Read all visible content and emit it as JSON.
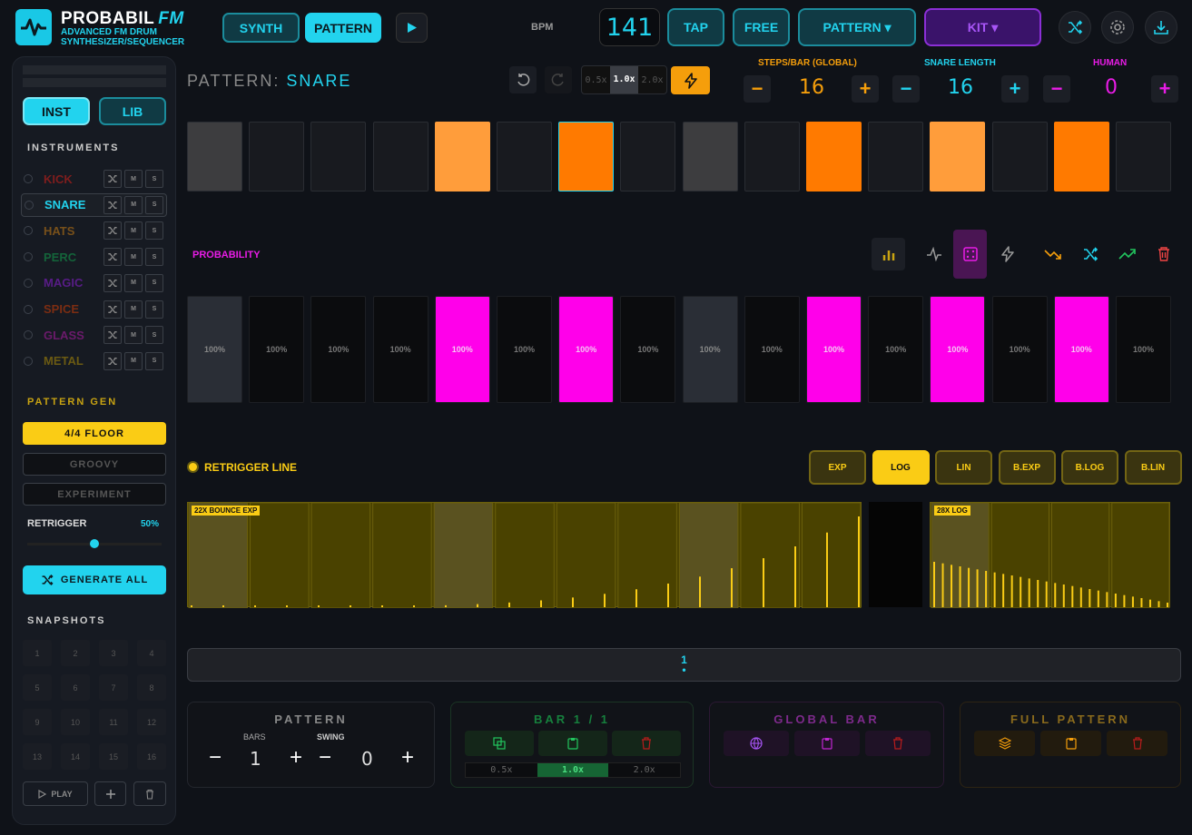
{
  "app": {
    "title": "PROBABIL",
    "title_suffix": "FM",
    "subtitle_line1": "ADVANCED FM DRUM",
    "subtitle_line2": "SYNTHESIZER/SEQUENCER"
  },
  "header": {
    "tab_synth": "SYNTH",
    "tab_pattern": "PATTERN",
    "bpm_label": "BPM",
    "bpm_value": "141",
    "tap": "TAP",
    "free": "FREE",
    "pattern_menu": "PATTERN ▾",
    "kit_menu": "KIT ▾"
  },
  "sidebar": {
    "inst_tab": "INST",
    "lib_tab": "LIB",
    "instruments_title": "INSTRUMENTS",
    "instruments": [
      {
        "name": "KICK",
        "color": "#7f1d1d"
      },
      {
        "name": "SNARE",
        "color": "#22d3ee"
      },
      {
        "name": "HATS",
        "color": "#78501a"
      },
      {
        "name": "PERC",
        "color": "#14643a"
      },
      {
        "name": "MAGIC",
        "color": "#581c87"
      },
      {
        "name": "SPICE",
        "color": "#7c2d12"
      },
      {
        "name": "GLASS",
        "color": "#6b1a6b"
      },
      {
        "name": "METAL",
        "color": "#6b5a12"
      }
    ],
    "mini_mute": "M",
    "mini_solo": "S",
    "pattern_gen_title": "PATTERN GEN",
    "gen_floor": "4/4 FLOOR",
    "gen_groovy": "GROOVY",
    "gen_experiment": "EXPERIMENT",
    "retrigger_label": "RETRIGGER",
    "retrigger_value": "50%",
    "generate_all": "GENERATE ALL",
    "snapshots_title": "SNAPSHOTS",
    "snapshots": [
      "1",
      "2",
      "3",
      "4",
      "5",
      "6",
      "7",
      "8",
      "9",
      "10",
      "11",
      "12",
      "13",
      "14",
      "15",
      "16"
    ],
    "play": "PLAY"
  },
  "main": {
    "pattern_prefix": "PATTERN:",
    "pattern_name": "SNARE",
    "speed_options": [
      "0.5x",
      "1.0x",
      "2.0x"
    ],
    "steps_label": "STEPS/BAR (GLOBAL)",
    "steps_value": "16",
    "length_label": "SNARE LENGTH",
    "length_value": "16",
    "human_label": "HUMAN",
    "human_value": "0",
    "minus": "−",
    "plus": "+",
    "steps": [
      "gray",
      "off",
      "off",
      "off",
      "orange-light",
      "off",
      "orange-sel",
      "off",
      "gray",
      "off",
      "orange",
      "off",
      "orange-light",
      "off",
      "orange",
      "off"
    ],
    "probability_label": "PROBABILITY",
    "probabilities": [
      "100%",
      "100%",
      "100%",
      "100%",
      "100%",
      "100%",
      "100%",
      "100%",
      "100%",
      "100%",
      "100%",
      "100%",
      "100%",
      "100%",
      "100%",
      "100%"
    ],
    "prob_states": [
      "gray",
      "off",
      "off",
      "off",
      "on",
      "off",
      "on",
      "off",
      "gray",
      "off",
      "on",
      "off",
      "on",
      "off",
      "on",
      "off"
    ],
    "retrigger_line_label": "RETRIGGER LINE",
    "curve_options": [
      "EXP",
      "LOG",
      "LIN",
      "B.EXP",
      "B.LOG",
      "B.LIN"
    ],
    "curve_selected": "LOG",
    "retrigger_tag_1": "22X BOUNCE EXP",
    "retrigger_tag_2": "28X LOG",
    "bar_strip_number": "1",
    "bar_strip_dot": "•"
  },
  "panels": {
    "pattern_title": "PATTERN",
    "bars_label": "BARS",
    "bars_value": "1",
    "swing_label": "SWING",
    "swing_value": "0",
    "bar_title": "BAR 1 / 1",
    "bar_speeds": [
      "0.5x",
      "1.0x",
      "2.0x"
    ],
    "global_bar_title": "GLOBAL BAR",
    "full_pattern_title": "FULL PATTERN"
  },
  "colors": {
    "accent": "#22d3ee",
    "orange": "#ff7a00",
    "magenta": "#ff00ea",
    "yellow": "#facc15",
    "purple": "#a855f7"
  }
}
